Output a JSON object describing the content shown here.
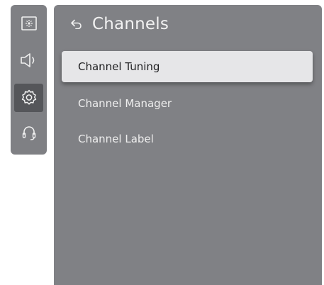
{
  "sidebar": {
    "items": [
      {
        "icon": "picture-settings-icon",
        "active": false
      },
      {
        "icon": "sound-icon",
        "active": false
      },
      {
        "icon": "gear-icon",
        "active": true
      },
      {
        "icon": "support-headset-icon",
        "active": false
      }
    ]
  },
  "header": {
    "back_icon": "back-arrow-icon",
    "title": "Channels"
  },
  "menu": {
    "items": [
      {
        "label": "Channel Tuning",
        "selected": true
      },
      {
        "label": "Channel Manager",
        "selected": false
      },
      {
        "label": "Channel Label",
        "selected": false
      }
    ]
  },
  "colors": {
    "panel_bg": "#808185",
    "rail_bg": "#7f8084",
    "selected_bg": "#e6e6e8",
    "active_rail_bg": "#55565a"
  }
}
